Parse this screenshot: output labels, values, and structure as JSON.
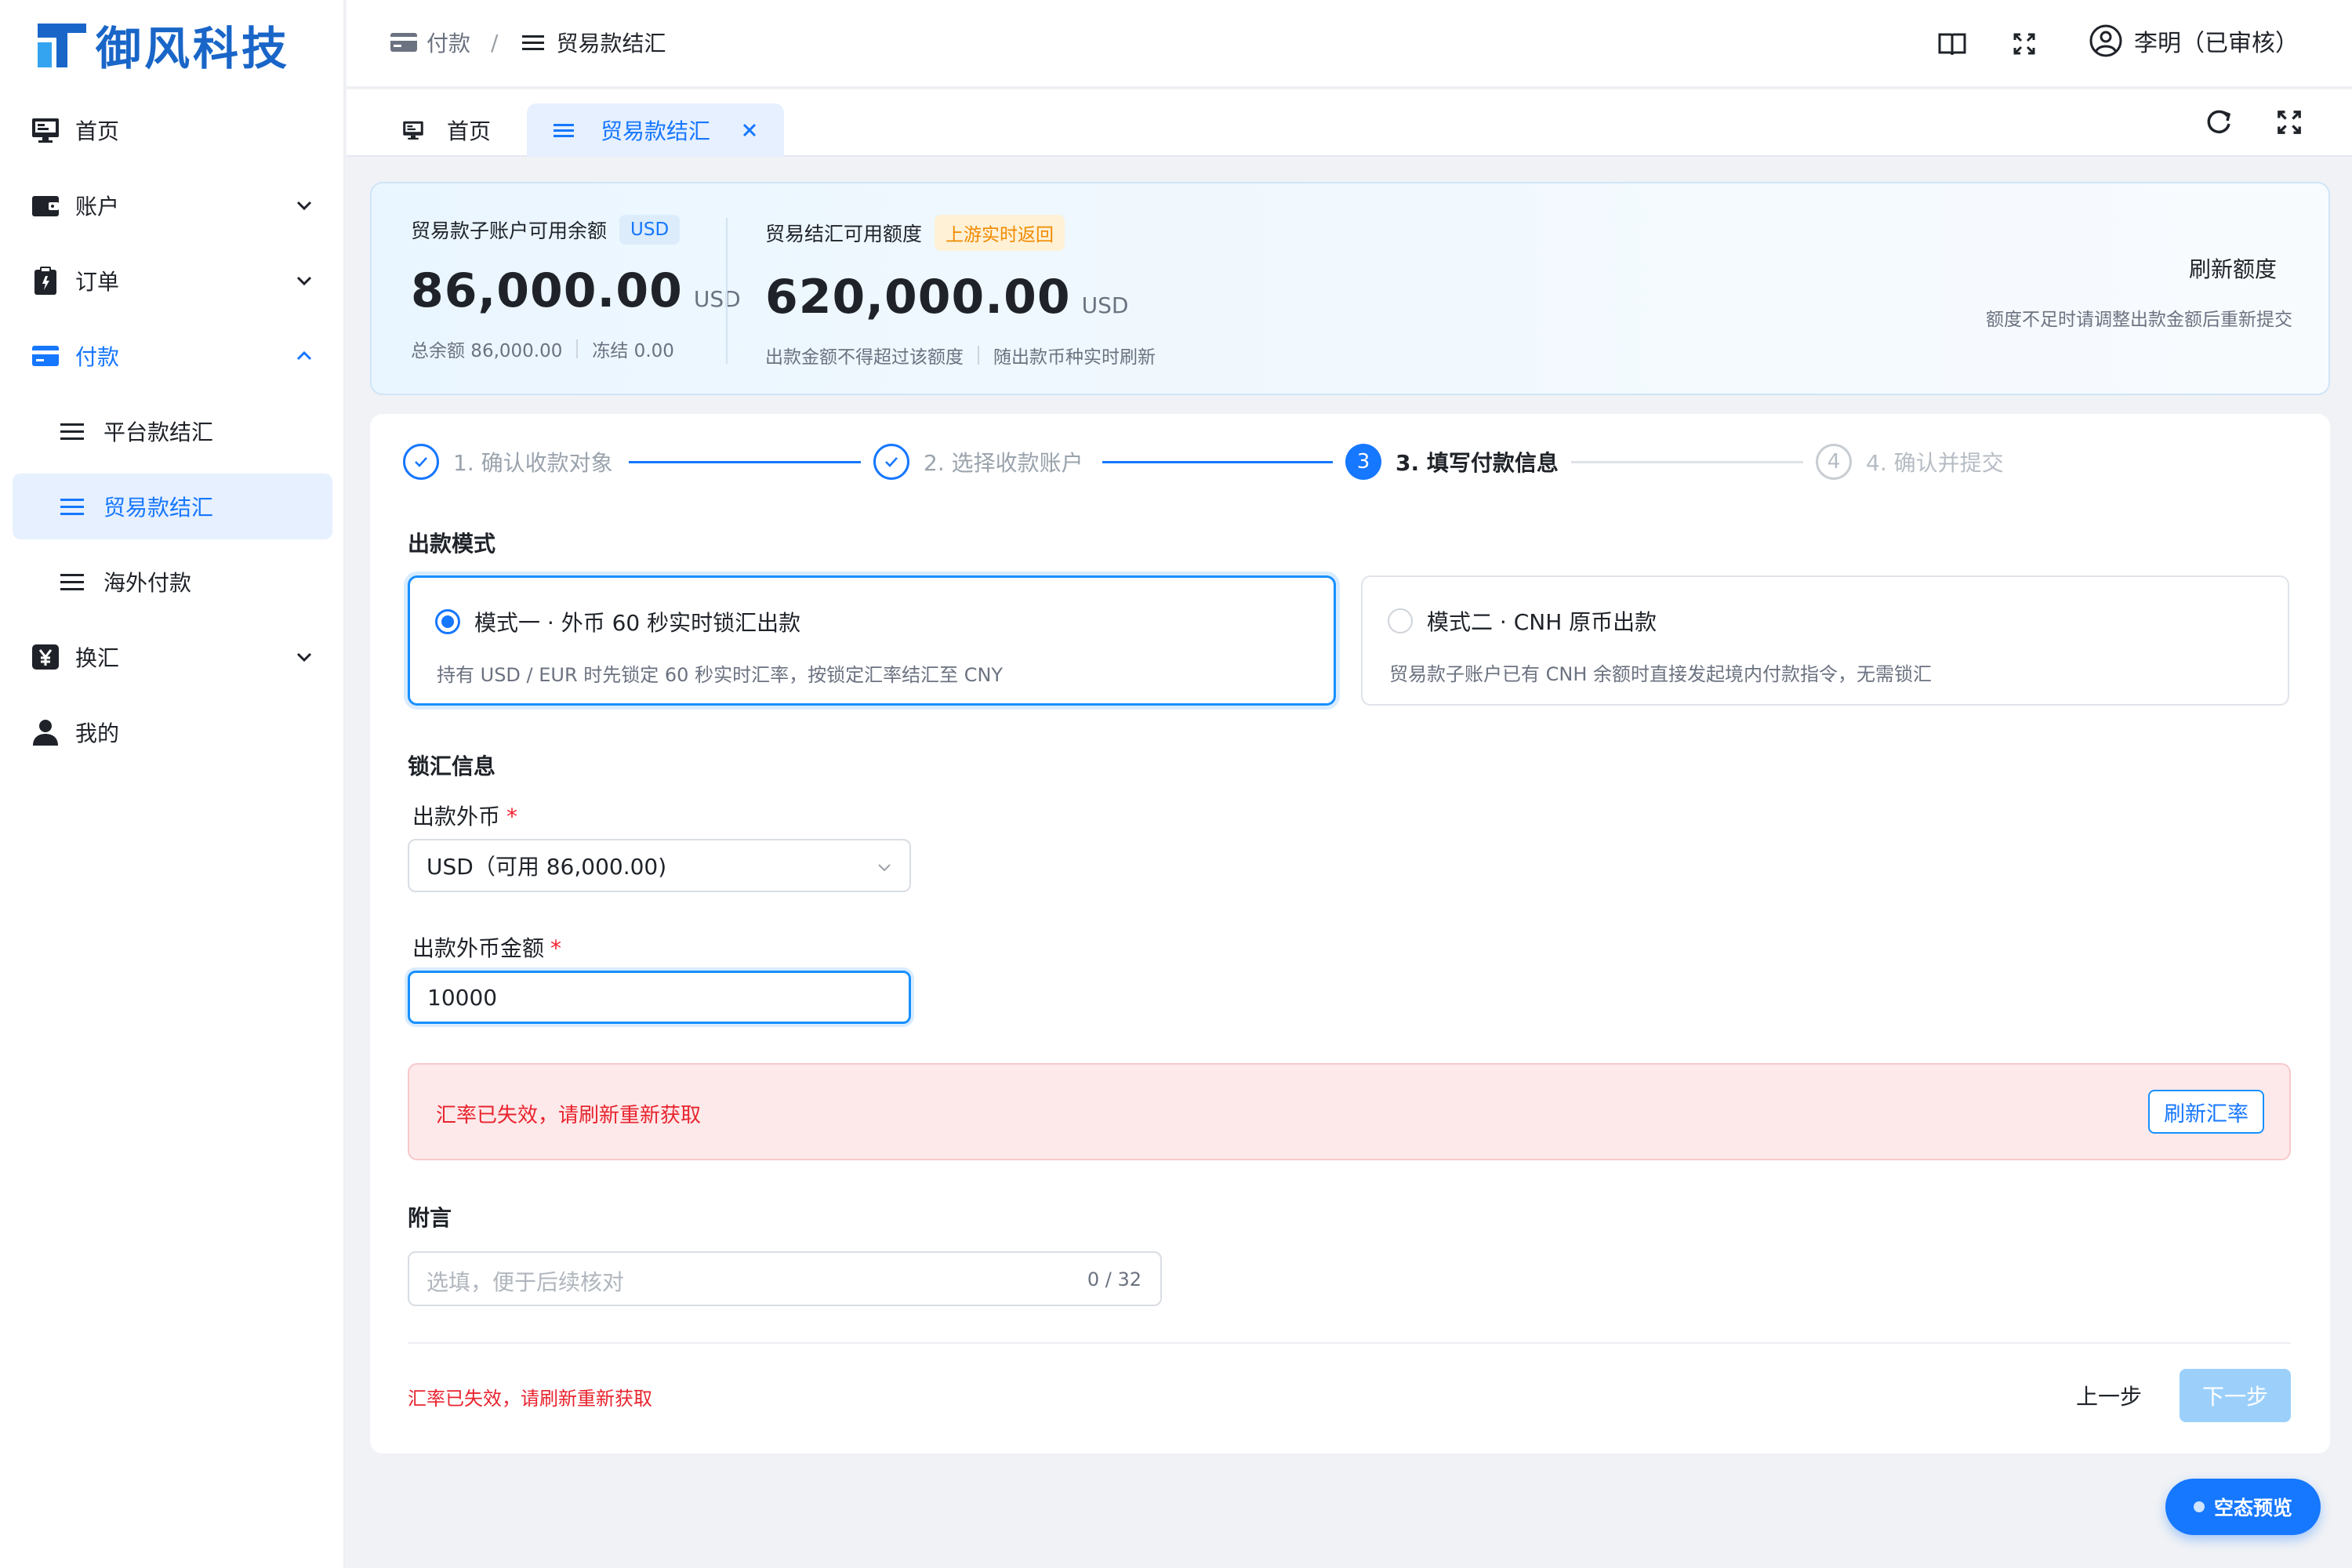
{
  "brand": {
    "name": "御风科技",
    "color": "#1966c8"
  },
  "accent": "#1677ff",
  "sidebar": {
    "items": [
      {
        "label": "首页",
        "icon": "desktop-icon"
      },
      {
        "label": "账户",
        "icon": "wallet-icon"
      },
      {
        "label": "订单",
        "icon": "clipboard-icon"
      },
      {
        "label": "付款",
        "icon": "credit-card-icon"
      },
      {
        "label": "平台款结汇",
        "icon": "menu-lines-icon"
      },
      {
        "label": "贸易款结汇",
        "icon": "menu-lines-icon"
      },
      {
        "label": "海外付款",
        "icon": "menu-lines-icon"
      },
      {
        "label": "换汇",
        "icon": "yen-icon"
      },
      {
        "label": "我的",
        "icon": "user-icon"
      }
    ]
  },
  "header": {
    "breadcrumb": [
      "付款",
      "/",
      "贸易款结汇"
    ],
    "user": "李明（已审核）"
  },
  "tabs": [
    {
      "label": "首页"
    },
    {
      "label": "贸易款结汇"
    }
  ],
  "balance": {
    "sub_account": {
      "label": "贸易款子账户可用余额",
      "tag": "USD",
      "amount": "86,000.00",
      "currency": "USD",
      "total": "总余额 86,000.00",
      "frozen": "冻结 0.00"
    },
    "quota": {
      "label": "贸易结汇可用额度",
      "tag": "上游实时返回",
      "amount": "620,000.00",
      "currency": "USD",
      "note1": "出款金额不得超过该额度",
      "note2": "随出款币种实时刷新"
    },
    "refresh_label": "刷新额度",
    "refresh_hint": "额度不足时请调整出款金额后重新提交"
  },
  "steps": [
    {
      "label": "1. 确认收款对象",
      "state": "done"
    },
    {
      "label": "2. 选择收款账户",
      "state": "done"
    },
    {
      "label": "3. 填写付款信息",
      "state": "current",
      "num": "3"
    },
    {
      "label": "4. 确认并提交",
      "state": "todo",
      "num": "4"
    }
  ],
  "form": {
    "mode_title": "出款模式",
    "modes": [
      {
        "title": "模式一 · 外币 60 秒实时锁汇出款",
        "desc": "持有 USD / EUR 时先锁定 60 秒实时汇率，按锁定汇率结汇至 CNY",
        "selected": true
      },
      {
        "title": "模式二 · CNH 原币出款",
        "desc": "贸易款子账户已有 CNH 余额时直接发起境内付款指令，无需锁汇",
        "selected": false
      }
    ],
    "lock_title": "锁汇信息",
    "currency_label": "出款外币",
    "currency_value": "USD（可用 86,000.00)",
    "amount_label": "出款外币金额",
    "amount_value": "10000",
    "required_mark": "*",
    "alert_message": "汇率已失效，请刷新重新获取",
    "alert_button": "刷新汇率",
    "remark_title": "附言",
    "remark_placeholder": "选填，便于后续核对",
    "remark_counter": "0 / 32",
    "footer_error": "汇率已失效，请刷新重新获取",
    "prev_label": "上一步",
    "next_label": "下一步"
  },
  "float_button": "空态预览"
}
